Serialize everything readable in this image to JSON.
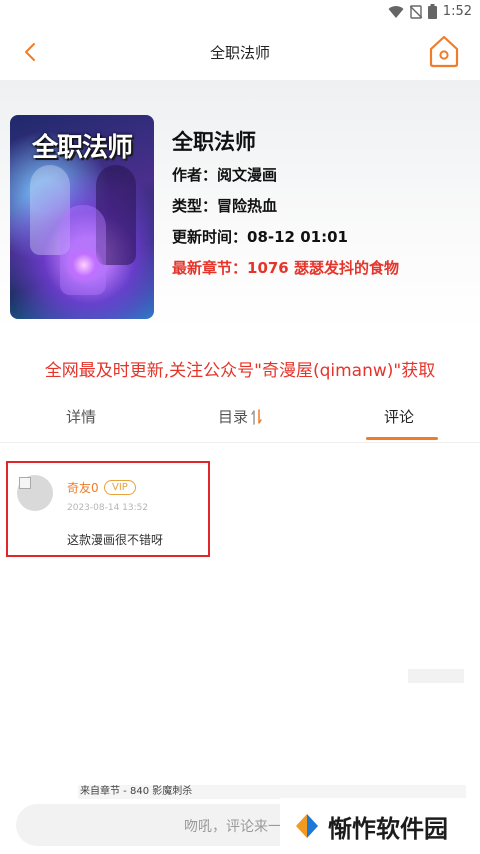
{
  "status": {
    "time": "1:52"
  },
  "nav": {
    "title": "全职法师"
  },
  "book": {
    "cover_text": "全职法师",
    "title": "全职法师",
    "author": "作者：阅文漫画",
    "genre": "类型：冒险热血",
    "updated": "更新时间：08-12 01:01",
    "latest": "最新章节：1076 瑟瑟发抖的食物"
  },
  "notice": "全网最及时更新,关注公众号\"奇漫屋(qimanw)\"获取",
  "tabs": {
    "detail": "详情",
    "catalog": "目录",
    "comment": "评论"
  },
  "comment": {
    "username": "奇友0",
    "badge": "VIP",
    "time": "2023-08-14 13:52",
    "content": "这款漫画很不错呀"
  },
  "source": "来自章节 - 840 影魔刺杀",
  "input": {
    "placeholder": "吻吼，评论来一"
  },
  "watermark": "惭怍软件园",
  "colors": {
    "accent": "#f07c29",
    "red": "#e5352b",
    "highlight_box": "#e0262a"
  },
  "icons": [
    "wifi-icon",
    "sim-off-icon",
    "battery-icon",
    "back-arrow-icon",
    "home-icon",
    "sort-icon",
    "watermark-logo-icon"
  ]
}
